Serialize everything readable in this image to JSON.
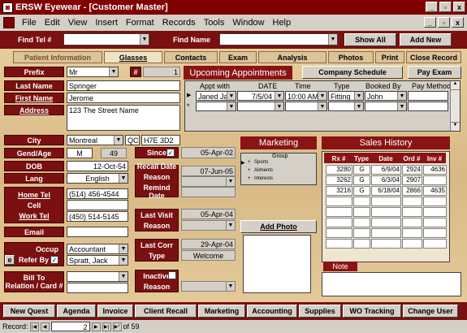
{
  "window": {
    "title": "ERSW Eyewear - [Customer Master]",
    "min": "_",
    "max": "▫",
    "close": "x"
  },
  "menu": [
    "File",
    "Edit",
    "View",
    "Insert",
    "Format",
    "Records",
    "Tools",
    "Window",
    "Help"
  ],
  "toolbar": {
    "find_tel_label": "Find Tel #",
    "find_name_label": "Find Name",
    "show_all": "Show All",
    "add_new": "Add New"
  },
  "tabs": [
    "Patient Information",
    "Glasses",
    "Contacts",
    "Exam",
    "Analysis",
    "Photos",
    "Print",
    "Close Record"
  ],
  "form": {
    "prefix_label": "Prefix",
    "prefix": "Mr",
    "hash_label": "#",
    "hash_value": "1",
    "last_name_label": "Last Name",
    "last_name": "Springer",
    "first_name_label": "First Name",
    "first_name": "Jerome",
    "address_label": "Address",
    "address": "123 The Street Name",
    "city_label": "City",
    "city": "Montreal",
    "province": "QC",
    "postal": "H7E 3D2",
    "gend_age_label": "Gend/Age",
    "gender": "M",
    "age": "49",
    "dob_label": "DOB",
    "dob": "12-Oct-54",
    "lang_label": "Lang",
    "lang": "English",
    "home_tel_label": "Home Tel",
    "home_tel": "(514) 456-4544",
    "cell_label": "Cell",
    "cell": "",
    "work_tel_label": "Work Tel",
    "work_tel": "(450) 514-5145",
    "email_label": "Email",
    "email": "",
    "occup_label": "Occup",
    "occup": "Accountant",
    "refer_label": "Refer By",
    "refer": "Spratt, Jack",
    "e_btn": "e",
    "bill_to_label": "Bill To",
    "relation_label": "Relation / Card #"
  },
  "since": {
    "label": "Since",
    "value": "05-Apr-02"
  },
  "recall": {
    "date_label": "Recall Date",
    "date": "07-Jun-05",
    "reason_label": "Reason",
    "remind_label": "Remind Date"
  },
  "lastvisit": {
    "label": "Last Visit",
    "date": "05-Apr-04",
    "reason_label": "Reason"
  },
  "lastcorr": {
    "label": "Last Corr",
    "date": "29-Apr-04",
    "type_label": "Type",
    "type": "Welcome"
  },
  "inactive": {
    "label": "Inactive",
    "reason_label": "Reason"
  },
  "appointments": {
    "header": "Upcoming Appointments",
    "company_btn": "Company Schedule",
    "pay_btn": "Pay Exam",
    "columns": [
      "Appt with",
      "DATE",
      "Time",
      "Type",
      "Booked By",
      "Pay Method"
    ],
    "rows": [
      [
        "Janed Ja",
        "7/5/04",
        "10:00 AM",
        "Fitting",
        "John",
        ""
      ]
    ]
  },
  "marketing": {
    "header": "Marketing",
    "col": "Group",
    "rows": [
      "Sports",
      "Ailments",
      "Interests"
    ],
    "add_photo": "Add Photo"
  },
  "sales": {
    "header": "Sales History",
    "columns": [
      "Rx #",
      "Type",
      "Date",
      "Ord #",
      "Inv #"
    ],
    "rows": [
      [
        "3280",
        "G",
        "6/9/04",
        "2924",
        "4636"
      ],
      [
        "3262",
        "G",
        "6/3/04",
        "2907",
        ""
      ],
      [
        "3216",
        "G",
        "6/18/04",
        "2866",
        "4635"
      ]
    ]
  },
  "note_label": "Note",
  "bottom": [
    "New Quest",
    "Agenda",
    "Invoice",
    "Client Recall",
    "Marketing",
    "Accounting",
    "Supplies",
    "WO Tracking",
    "Change User"
  ],
  "status": {
    "record_label": "Record:",
    "current": "2",
    "of": "of  59"
  }
}
